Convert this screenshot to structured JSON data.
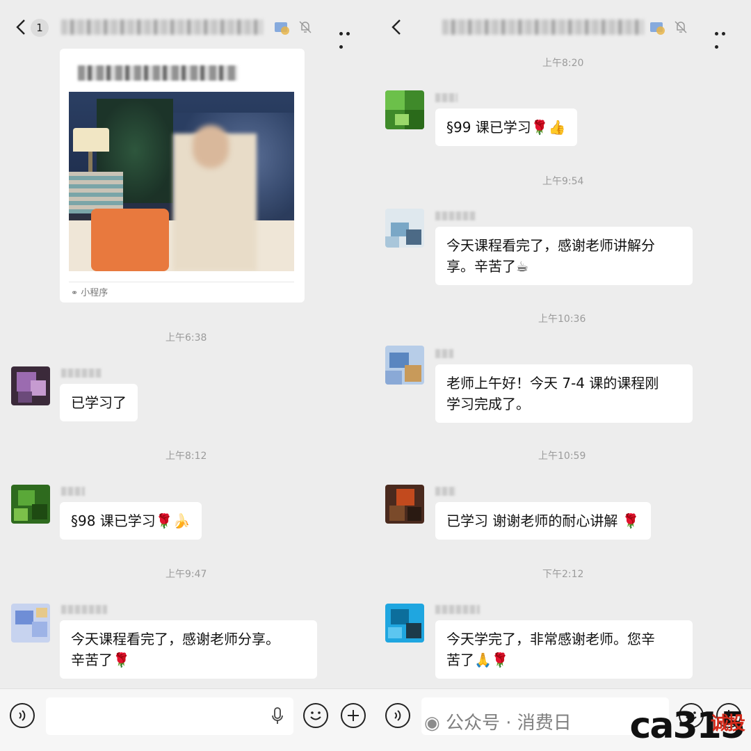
{
  "left": {
    "header": {
      "unread_count": "1"
    },
    "mini_card": {
      "footer_label": "小程序"
    },
    "messages": [
      {
        "time": "上午6:38",
        "text": "已学习了"
      },
      {
        "time": "上午8:12",
        "text": "§98 课已学习🌹🍌"
      },
      {
        "time": "上午9:47",
        "text_line1": "今天课程看完了，感谢老师分享。",
        "text_line2": "辛苦了🌹"
      }
    ]
  },
  "right": {
    "messages": [
      {
        "time": "上午8:20",
        "text": "§99 课已学习🌹👍"
      },
      {
        "time": "上午9:54",
        "text_line1": "今天课程看完了，感谢老师讲解分",
        "text_line2": "享。辛苦了☕"
      },
      {
        "time": "上午10:36",
        "text_line1": "老师上午好！今天 7-4 课的课程刚",
        "text_line2": "学习完成了。"
      },
      {
        "time": "上午10:59",
        "text": "已学习 谢谢老师的耐心讲解 🌹"
      },
      {
        "time": "下午2:12",
        "text_line1": "今天学完了，非常感谢老师。您辛",
        "text_line2": "苦了🙏🌹"
      }
    ]
  },
  "watermark": {
    "account_text": "公众号 · 消费日",
    "logo_text": "ca315",
    "logo_red": "诚投"
  }
}
